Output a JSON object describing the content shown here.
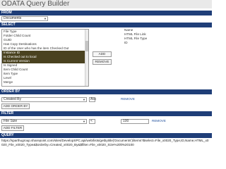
{
  "app": {
    "title": "ODATA Query Builder"
  },
  "from": {
    "header": "FROM",
    "selected": "Documents"
  },
  "select": {
    "header": "SELECT",
    "available": [
      "File Type",
      "Folder Child Count",
      "GUID",
      "Has Copy Destinations",
      "ID of the User who has the item Checked Out",
      "Instance ID",
      "Is Checked out to local",
      "Is Current Version",
      "Is Signed",
      "Item Child Count",
      "Item Type",
      "Level",
      "Merge"
    ],
    "selected_items": [
      "Instance ID",
      "Is Checked out to local",
      "Is Current Version"
    ],
    "add_label": "ADD",
    "remove_label": "REMOVE",
    "chosen": [
      "Name",
      "HTML File Link",
      "HTML File Type",
      "ID"
    ]
  },
  "order_by": {
    "header": "ORDER BY",
    "field": "Created By",
    "direction": "Asc",
    "remove_label": "REMOVE",
    "add_label": "ADD ORDER BY"
  },
  "filter": {
    "header": "FILTER",
    "field": "File Size",
    "operator": "<",
    "value": "100",
    "remove_label": "REMOVE",
    "add_label": "ADD FILTER"
  },
  "query": {
    "header": "QUERY",
    "text": "https://sparthugroup.sharepoint.com/sites/DevelopSPC.api/web/lists/getbytitle('Documents')/items?$select=File_x0020_Type,ID,Name,HTML_x0020_File_x0020_Type&$orderby=Created_x0020_By&$filter=File_x0020_Size%20lt%20100"
  }
}
